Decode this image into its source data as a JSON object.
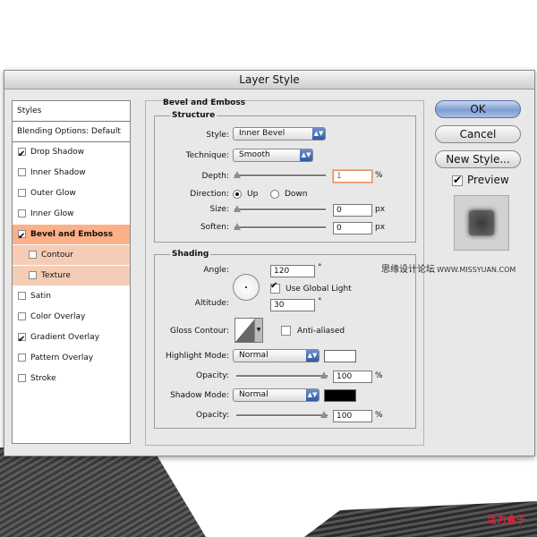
{
  "dialog": {
    "title": "Layer Style"
  },
  "styles_list": {
    "header": "Styles",
    "blending": "Blending Options: Default",
    "items": [
      {
        "label": "Drop Shadow",
        "checked": true
      },
      {
        "label": "Inner Shadow",
        "checked": false
      },
      {
        "label": "Outer Glow",
        "checked": false
      },
      {
        "label": "Inner Glow",
        "checked": false
      },
      {
        "label": "Bevel and Emboss",
        "checked": true,
        "active": true
      },
      {
        "label": "Contour",
        "checked": false,
        "sub": true
      },
      {
        "label": "Texture",
        "checked": false,
        "sub": true
      },
      {
        "label": "Satin",
        "checked": false
      },
      {
        "label": "Color Overlay",
        "checked": false
      },
      {
        "label": "Gradient Overlay",
        "checked": true
      },
      {
        "label": "Pattern Overlay",
        "checked": false
      },
      {
        "label": "Stroke",
        "checked": false
      }
    ]
  },
  "bevel": {
    "section_title": "Bevel and Emboss",
    "structure": {
      "title": "Structure",
      "style_label": "Style:",
      "style_value": "Inner Bevel",
      "technique_label": "Technique:",
      "technique_value": "Smooth",
      "depth_label": "Depth:",
      "depth_value": "1",
      "depth_unit": "%",
      "direction_label": "Direction:",
      "direction_up": "Up",
      "direction_down": "Down",
      "size_label": "Size:",
      "size_value": "0",
      "size_unit": "px",
      "soften_label": "Soften:",
      "soften_value": "0",
      "soften_unit": "px"
    },
    "shading": {
      "title": "Shading",
      "angle_label": "Angle:",
      "angle_value": "120",
      "angle_unit": "°",
      "global_light": "Use Global Light",
      "altitude_label": "Altitude:",
      "altitude_value": "30",
      "altitude_unit": "°",
      "gloss_label": "Gloss Contour:",
      "anti_aliased": "Anti-aliased",
      "highlight_mode_label": "Highlight Mode:",
      "highlight_mode_value": "Normal",
      "highlight_color": "#ffffff",
      "highlight_opacity_label": "Opacity:",
      "highlight_opacity_value": "100",
      "shadow_mode_label": "Shadow Mode:",
      "shadow_mode_value": "Normal",
      "shadow_color": "#000000",
      "shadow_opacity_label": "Opacity:",
      "shadow_opacity_value": "100",
      "percent": "%"
    }
  },
  "buttons": {
    "ok": "OK",
    "cancel": "Cancel",
    "new_style": "New Style...",
    "preview": "Preview"
  },
  "watermarks": {
    "top": "思缘设计论坛",
    "top_url": "WWW.MISSYUAN.COM",
    "bottom": "活力盒子"
  }
}
